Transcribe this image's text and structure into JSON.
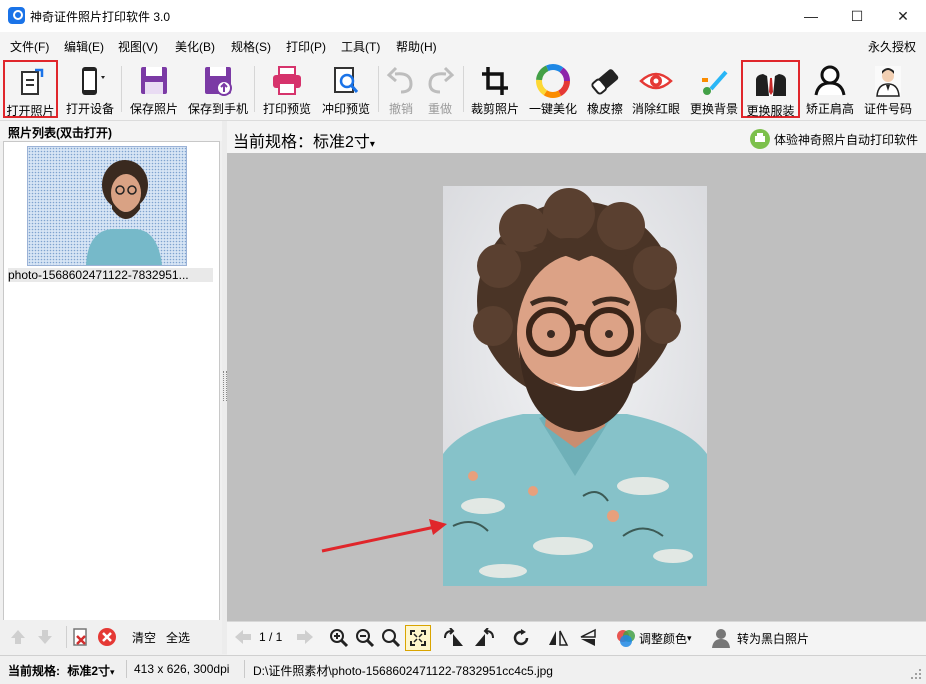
{
  "window": {
    "title": "神奇证件照片打印软件 3.0",
    "minimize": "—",
    "maximize": "☐",
    "close": "✕"
  },
  "menu": {
    "items": [
      "文件(F)",
      "编辑(E)",
      "视图(V)",
      "美化(B)",
      "规格(S)",
      "打印(P)",
      "工具(T)",
      "帮助(H)"
    ],
    "license": "永久授权"
  },
  "toolbar": {
    "open_photo": "打开照片",
    "open_device": "打开设备",
    "save_photo": "保存照片",
    "save_to_phone": "保存到手机",
    "print_preview": "打印预览",
    "develop_preview": "冲印预览",
    "undo": "撤销",
    "redo": "重做",
    "crop": "裁剪照片",
    "one_click_beauty": "一键美化",
    "eraser": "橡皮擦",
    "remove_red_eye": "消除红眼",
    "change_background": "更换背景",
    "change_clothes": "更换服装",
    "correct_shoulders": "矫正肩高",
    "id_number": "证件号码"
  },
  "left_panel": {
    "header": "照片列表(双击打开)",
    "thumb_label": "photo-1568602471122-7832951...",
    "clear": "清空",
    "select_all": "全选"
  },
  "right_panel": {
    "spec_label": "当前规格：标准2寸",
    "auto_print": "体验神奇照片自动打印软件"
  },
  "bottom_tools": {
    "page": "1 / 1",
    "adjust_color": "调整颜色",
    "to_bw": "转为黑白照片"
  },
  "status": {
    "spec_prefix": "当前规格:",
    "spec_value": "标准2寸",
    "size": "413 x 626, 300dpi",
    "path": "D:\\证件照素材\\photo-1568602471122-7832951cc4c5.jpg"
  },
  "colors": {
    "highlight": "#e0262b",
    "arrow": "#e0262b",
    "accent": "#1a73e8"
  }
}
